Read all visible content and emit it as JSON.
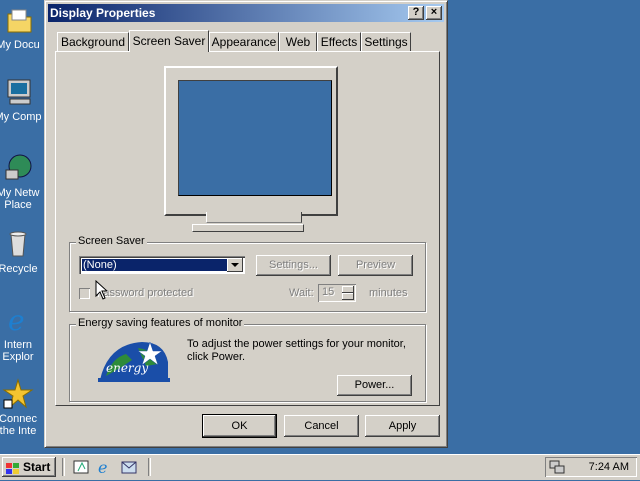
{
  "desktop": {
    "icons": [
      {
        "label": "My Docu",
        "icon": "folder-icon"
      },
      {
        "label": "My Comp",
        "icon": "computer-icon"
      },
      {
        "label": "My Netw",
        "label2": "Place",
        "icon": "network-icon"
      },
      {
        "label": "Recycle",
        "icon": "recycle-bin-icon"
      },
      {
        "label": "Intern",
        "label2": "Explor",
        "icon": "ie-icon"
      },
      {
        "label": "Connec",
        "label2": "the Inte",
        "icon": "connect-icon"
      }
    ]
  },
  "window": {
    "title": "Display Properties",
    "help_btn": "?",
    "close_btn": "×",
    "tabs": [
      {
        "label": "Background"
      },
      {
        "label": "Screen Saver",
        "active": true
      },
      {
        "label": "Appearance"
      },
      {
        "label": "Web"
      },
      {
        "label": "Effects"
      },
      {
        "label": "Settings"
      }
    ],
    "screensaver": {
      "group_title": "Screen Saver",
      "selected": "(None)",
      "settings_btn": "Settings...",
      "preview_btn": "Preview",
      "password_label": "Password protected",
      "wait_label": "Wait:",
      "wait_value": "15",
      "minutes_label": "minutes"
    },
    "energy": {
      "group_title": "Energy saving features of monitor",
      "description": "To adjust the power settings for your monitor, click Power.",
      "power_btn": "Power...",
      "logo_text": "energy"
    },
    "ok_btn": "OK",
    "cancel_btn": "Cancel",
    "apply_btn": "Apply"
  },
  "taskbar": {
    "start_label": "Start",
    "time": "7:24 AM"
  },
  "colors": {
    "desktop": "#3a6ea5",
    "titlebar_start": "#0a246a",
    "titlebar_end": "#a6caf0",
    "face": "#d4d0c8"
  }
}
